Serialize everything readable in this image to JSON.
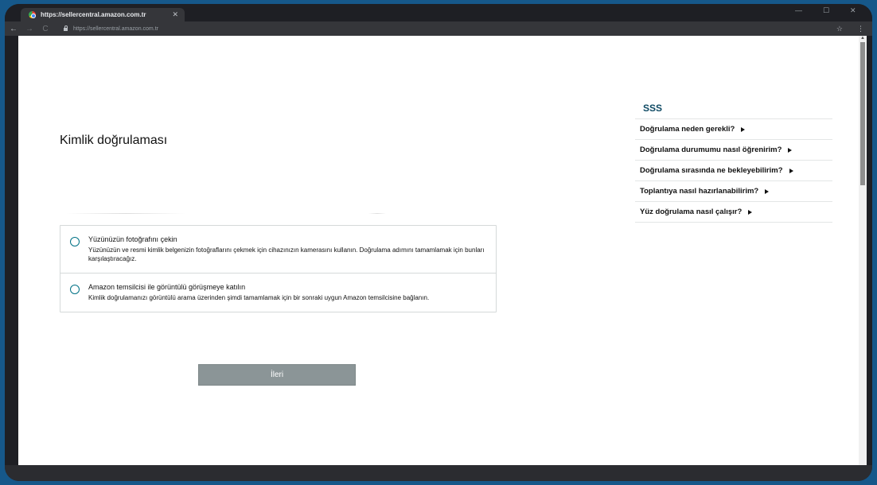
{
  "browser": {
    "tab_title": "https://sellercentral.amazon.com.tr",
    "tab_close": "✕",
    "url": "https://sellercentral.amazon.com.tr",
    "nav": {
      "back": "←",
      "forward": "→",
      "reload": "C"
    },
    "window_controls": {
      "minimize": "—",
      "maximize": "☐",
      "close": "✕"
    },
    "toolbar_right": {
      "bookmark": "☆",
      "menu": "⋮"
    }
  },
  "page": {
    "title": "Kimlik doğrulaması",
    "options": [
      {
        "title": "Yüzünüzün fotoğrafını çekin",
        "description": "Yüzünüzün ve resmi kimlik belgenizin fotoğraflarını çekmek için cihazınızın kamerasını kullanın. Doğrulama adımını tamamlamak için bunları karşılaştıracağız."
      },
      {
        "title": "Amazon temsilcisi ile görüntülü görüşmeye katılın",
        "description": "Kimlik doğrulamanızı görüntülü arama üzerinden şimdi tamamlamak için bir sonraki uygun Amazon temsilcisine bağlanın."
      }
    ],
    "next_button": "İleri"
  },
  "faq": {
    "title": "SSS",
    "items": [
      "Doğrulama neden gerekli?",
      "Doğrulama durumumu nasıl öğrenirim?",
      "Doğrulama sırasında ne bekleyebilirim?",
      "Toplantıya nasıl hazırlanabilirim?",
      "Yüz doğrulama nasıl çalışır?"
    ]
  },
  "colors": {
    "frame_background": "#16588a",
    "faq_title": "#0f4a64",
    "radio_border": "#007185",
    "next_button": "#8b9597"
  }
}
